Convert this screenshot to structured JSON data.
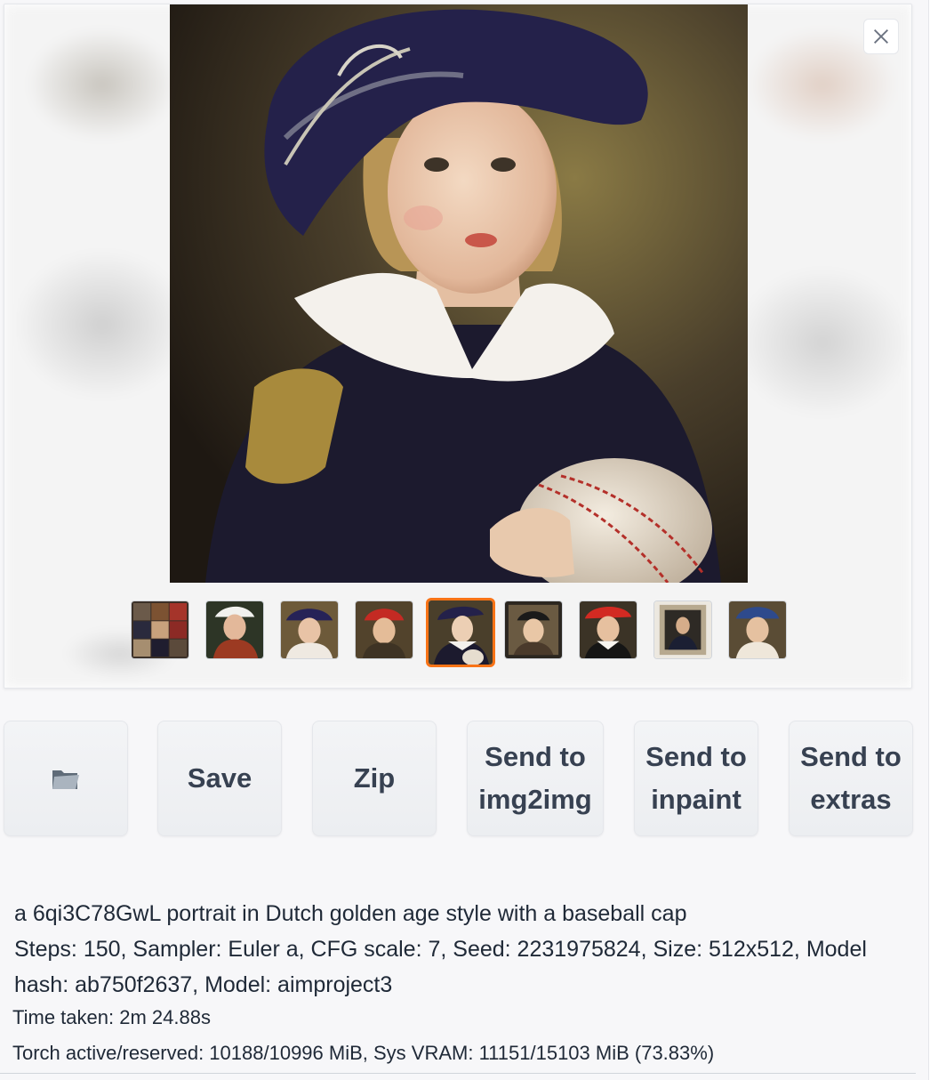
{
  "gallery": {
    "close_icon": "close-icon",
    "main_image_alt": "portrait",
    "thumbnails": [
      "grid",
      "maid",
      "lady-blue-hat",
      "girl-red-cap",
      "boy-baseball",
      "framed-girl",
      "girl-red-beret",
      "framed-man",
      "girl-blue-cap"
    ],
    "selected_index": 4
  },
  "actions": {
    "folder_icon": "folder-icon",
    "save_label": "Save",
    "zip_label": "Zip",
    "img2img_line1": "Send to",
    "img2img_line2": "img2img",
    "inpaint_line1": "Send to",
    "inpaint_line2": "inpaint",
    "extras_line1": "Send to",
    "extras_line2": "extras"
  },
  "generation_info": {
    "prompt": "a 6qi3C78GwL portrait in Dutch golden age style with a baseball cap",
    "params": "Steps: 150, Sampler: Euler a, CFG scale: 7, Seed: 2231975824, Size: 512x512, Model hash: ab750f2637, Model: aimproject3",
    "time_taken": "Time taken: 2m 24.88s",
    "vram": "Torch active/reserved: 10188/10996 MiB, Sys VRAM: 11151/15103 MiB (73.83%)"
  },
  "colors": {
    "accent": "#f97316",
    "button_bg": "#f3f4f6",
    "text": "#1f2937"
  }
}
